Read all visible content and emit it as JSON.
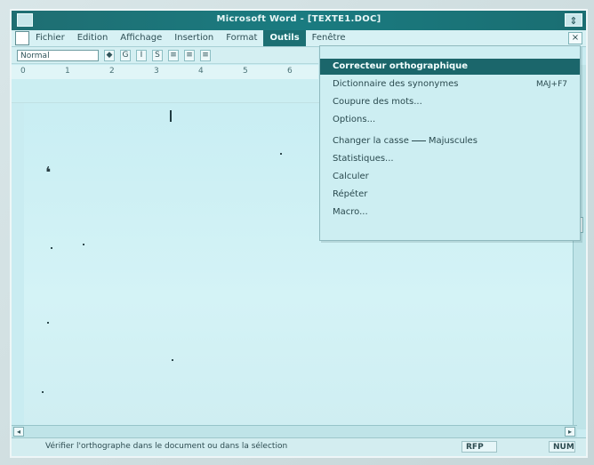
{
  "window": {
    "title": "Microsoft Word - [TEXTE1.DOC]",
    "restore_label": "⇕"
  },
  "menubar": {
    "items": [
      {
        "label": "Fichier"
      },
      {
        "label": "Edition"
      },
      {
        "label": "Affichage"
      },
      {
        "label": "Insertion"
      },
      {
        "label": "Format"
      },
      {
        "label": "Outils",
        "active": true
      },
      {
        "label": "Fenêtre"
      }
    ],
    "close_label": "×"
  },
  "toolbar": {
    "style_value": "Normal",
    "buttons": [
      "◆",
      "G",
      "I",
      "S",
      "≡",
      "≡",
      "≡"
    ]
  },
  "ruler": {
    "ticks": [
      "0",
      "1",
      "2",
      "3",
      "4",
      "5",
      "6"
    ]
  },
  "dropdown": {
    "items": [
      {
        "label": "Correcteur orthographique",
        "selected": true
      },
      {
        "label": "Dictionnaire des synonymes",
        "shortcut": "MAJ+F7"
      },
      {
        "label": "Coupure des mots..."
      },
      {
        "label": "Options..."
      },
      {
        "label": "Changer la casse",
        "arrow": true,
        "suffix": "Majuscules"
      },
      {
        "label": "Statistiques..."
      },
      {
        "label": "Calculer"
      },
      {
        "label": "Répéter"
      },
      {
        "label": "Macro..."
      }
    ]
  },
  "statusbar": {
    "status_text": "Vérifier l'orthographe dans le document ou dans la sélection",
    "ovr": "RFP",
    "caps": "NUM"
  }
}
